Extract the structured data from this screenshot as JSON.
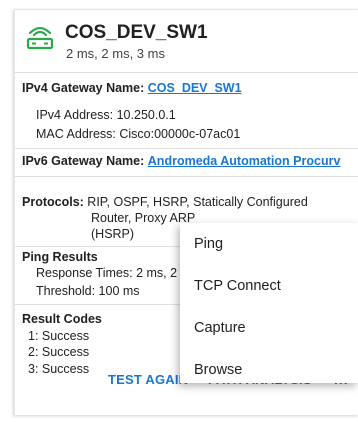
{
  "header": {
    "title": "COS_DEV_SW1",
    "subtitle": "2 ms, 2 ms, 3 ms",
    "icon": "network-switch-icon",
    "icon_color": "#2ba84a"
  },
  "ipv4": {
    "gateway_label": "IPv4 Gateway Name:",
    "gateway_value": "COS_DEV_SW1",
    "address_label": "IPv4 Address:",
    "address_value": "10.250.0.1",
    "mac_label": "MAC Address:",
    "mac_value": "Cisco:00000c-07ac01"
  },
  "ipv6": {
    "gateway_label": "IPv6 Gateway Name:",
    "gateway_value": "Andromeda Automation Procurv"
  },
  "protocols": {
    "label": "Protocols:",
    "line1": "RIP, OSPF, HSRP, Statically Configured",
    "line2": "Router, Proxy ARP",
    "line3": "(HSRP)"
  },
  "ping_results": {
    "heading": "Ping Results",
    "response_label": "Response Times:",
    "response_value": "2 ms, 2 ms, 3 ms",
    "threshold_label": "Threshold:",
    "threshold_value": "100 ms"
  },
  "result_codes": {
    "heading": "Result Codes",
    "items": [
      "1: Success",
      "2: Success",
      "3: Success"
    ]
  },
  "context_menu": {
    "items": [
      "Ping",
      "TCP Connect",
      "Capture",
      "Browse"
    ]
  },
  "actions": {
    "test_again": "TEST AGAIN",
    "path_analysis": "PATH ANALYSIS",
    "more": "..."
  },
  "colors": {
    "accent": "#1976d2",
    "status_icon": "#2ba84a"
  }
}
